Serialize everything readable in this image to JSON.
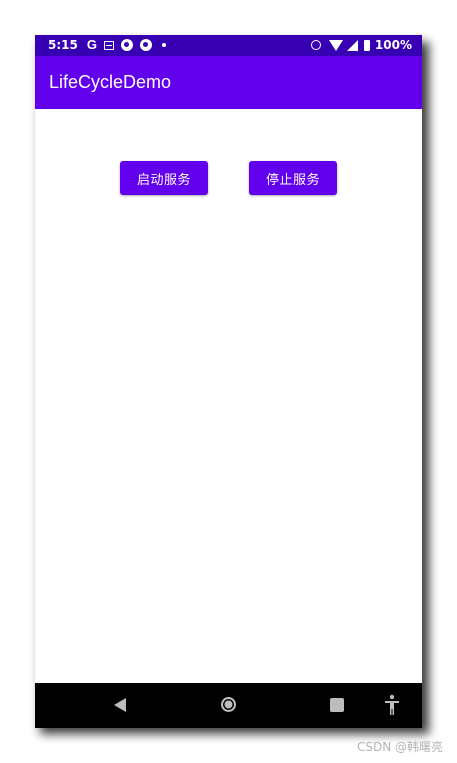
{
  "status_bar": {
    "time": "5:15",
    "google_glyph": "G",
    "battery_text": "100%",
    "icons": [
      "google-icon",
      "news-icon",
      "vpn-shield-icon",
      "vpn-shield-icon",
      "notification-dot-icon",
      "alarm-icon",
      "wifi-icon",
      "signal-icon",
      "battery-icon"
    ]
  },
  "app_bar": {
    "title": "LifeCycleDemo"
  },
  "buttons": {
    "start_label": "启动服务",
    "stop_label": "停止服务"
  },
  "nav_bar": {
    "icons": [
      "back-icon",
      "home-icon",
      "recents-icon",
      "accessibility-icon"
    ]
  },
  "watermark": "CSDN @韩曙亮",
  "colors": {
    "primary": "#6200ee",
    "primary_dark": "#3700b3",
    "nav_bar": "#000000",
    "background": "#ffffff"
  }
}
